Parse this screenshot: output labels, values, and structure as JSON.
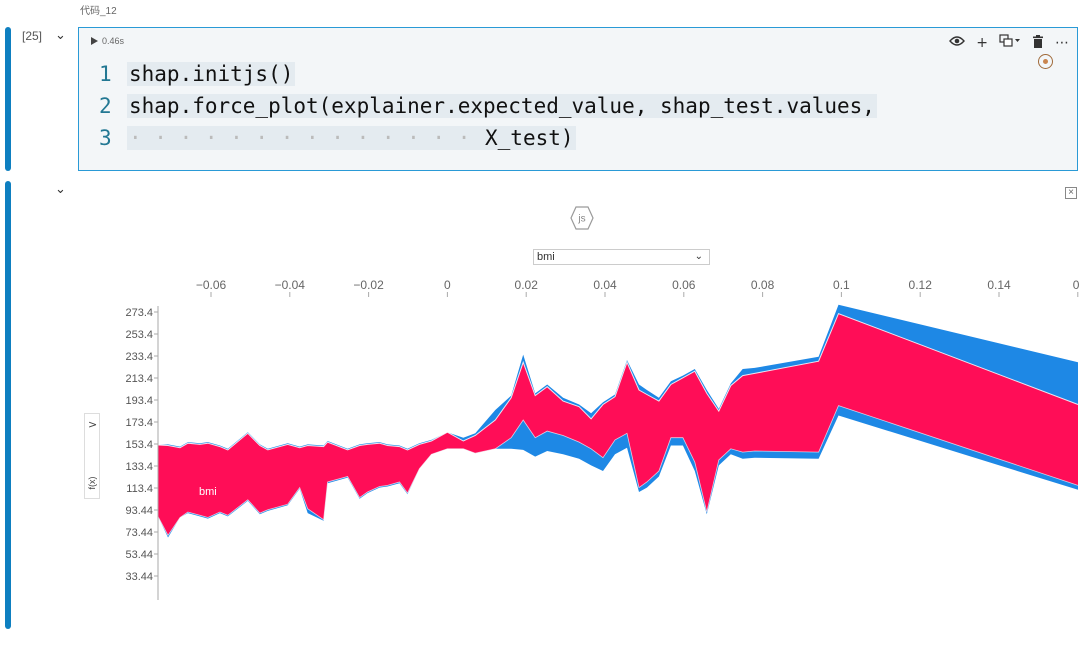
{
  "cell": {
    "label": "代码_12",
    "exec_count": "[25]",
    "run_time": "0.46s",
    "code_lines": [
      {
        "num": "1",
        "text": "shap.initjs()"
      },
      {
        "num": "2",
        "text": "shap.force_plot(explainer.expected_value, shap_test.values,"
      },
      {
        "num": "3",
        "text": "X_test)"
      }
    ],
    "toolbar": [
      "eye-icon",
      "plus-icon",
      "split-icon",
      "trash-icon",
      "more-icon"
    ]
  },
  "output": {
    "js_badge": "js",
    "close_label": "×",
    "feature_select": "bmi",
    "side_tab_label": "f(x)"
  },
  "chart_data": {
    "type": "area",
    "xlabel": "bmi",
    "ylabel": "f(x)",
    "x_ticks": [
      "−0.06",
      "−0.04",
      "−0.02",
      "0",
      "0.02",
      "0.04",
      "0.06",
      "0.08",
      "0.1",
      "0.12",
      "0.14",
      "0."
    ],
    "y_ticks": [
      "273.4",
      "253.4",
      "233.4",
      "213.4",
      "193.4",
      "173.4",
      "153.4",
      "133.4",
      "113.4",
      "93.44",
      "73.44",
      "53.44",
      "33.44"
    ],
    "xlim": [
      -0.0725,
      0.158
    ],
    "ylim": [
      33.44,
      273.4
    ],
    "colors": {
      "positive": "#ff0d57",
      "negative": "#1e88e5"
    },
    "annotations": [
      "bmi"
    ],
    "x": [
      -0.0725,
      -0.07,
      -0.067,
      -0.065,
      -0.062,
      -0.06,
      -0.057,
      -0.055,
      -0.05,
      -0.047,
      -0.045,
      -0.04,
      -0.037,
      -0.035,
      -0.031,
      -0.03,
      -0.025,
      -0.022,
      -0.02,
      -0.017,
      -0.015,
      -0.012,
      -0.01,
      -0.007,
      -0.004,
      0.0,
      0.004,
      0.007,
      0.012,
      0.016,
      0.019,
      0.022,
      0.025,
      0.029,
      0.033,
      0.036,
      0.039,
      0.042,
      0.045,
      0.048,
      0.05,
      0.053,
      0.056,
      0.059,
      0.062,
      0.065,
      0.068,
      0.071,
      0.074,
      0.077,
      0.093,
      0.098,
      0.158
    ],
    "top": [
      153.4,
      154,
      152,
      156,
      155,
      156,
      153,
      150,
      165,
      154,
      150,
      155,
      152,
      154,
      153,
      157,
      150,
      154,
      155,
      156,
      154,
      153,
      150,
      155,
      158,
      165,
      160,
      164,
      185,
      198,
      235,
      200,
      208,
      196,
      190,
      182,
      192,
      199,
      230,
      208,
      203,
      196,
      211,
      216,
      222,
      203,
      186,
      209,
      222,
      223,
      233,
      280,
      228
    ],
    "upper": [
      153.4,
      153,
      151,
      155,
      154,
      155,
      152,
      149,
      164,
      153,
      149,
      154,
      151,
      153,
      152,
      156,
      149,
      153,
      154,
      155,
      153,
      152,
      149,
      154,
      157,
      165,
      157,
      162,
      176,
      196,
      228,
      198,
      206,
      193,
      188,
      177,
      190,
      197,
      228,
      203,
      199,
      193,
      208,
      214,
      220,
      200,
      184,
      207,
      216,
      218,
      229,
      272,
      190
    ],
    "lower": [
      89,
      72,
      88,
      93,
      90,
      88,
      93,
      90,
      104,
      92,
      95,
      100,
      115,
      96,
      86,
      120,
      125,
      106,
      111,
      116,
      117,
      120,
      110,
      132,
      145,
      150,
      150,
      146,
      150,
      160,
      176,
      160,
      166,
      162,
      156,
      150,
      142,
      158,
      164,
      115,
      120,
      130,
      160,
      160,
      138,
      93,
      140,
      150,
      147,
      148,
      147,
      189,
      117
    ],
    "bottom": [
      89,
      70,
      88,
      92,
      89,
      87,
      92,
      89,
      103,
      91,
      94,
      99,
      114,
      92,
      85,
      119,
      124,
      105,
      110,
      115,
      116,
      119,
      109,
      132,
      145,
      150,
      150,
      146,
      150,
      150,
      149,
      143,
      148,
      145,
      141,
      135,
      130,
      145,
      151,
      111,
      115,
      125,
      153,
      153,
      130,
      91,
      135,
      145,
      141,
      142,
      141,
      180,
      113
    ],
    "grid": false,
    "legend": "none"
  }
}
